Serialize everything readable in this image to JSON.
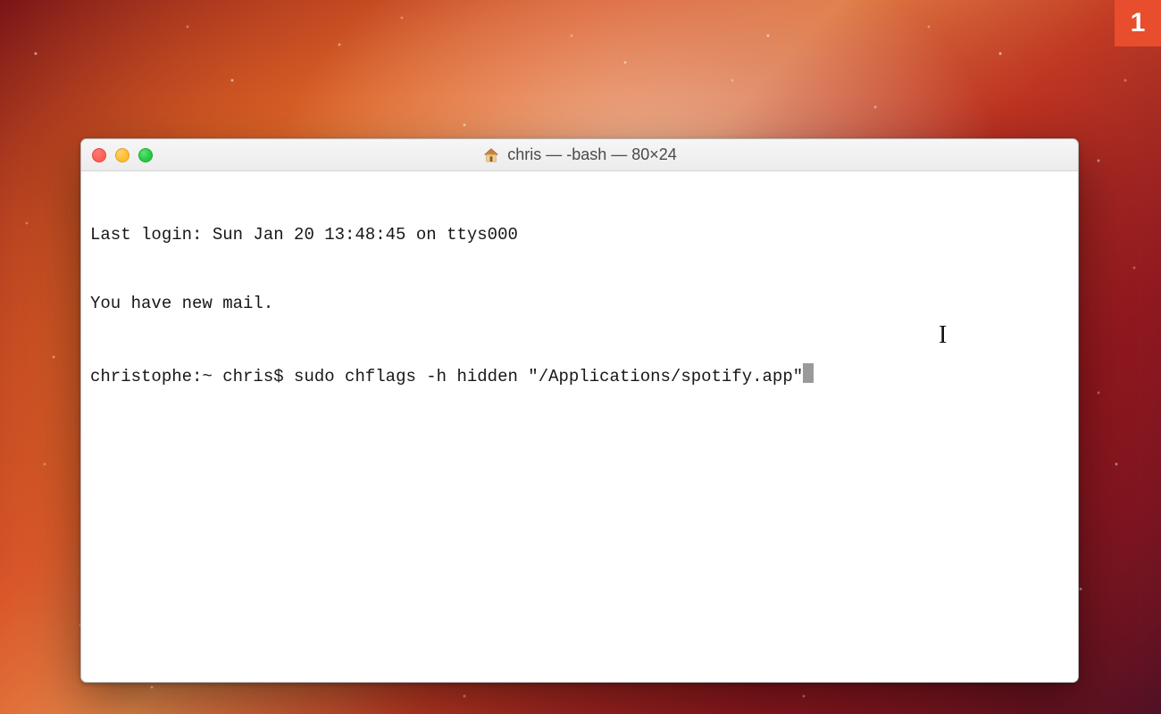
{
  "badge": {
    "number": "1",
    "bg": "#e84d2d"
  },
  "window": {
    "title": "chris — -bash — 80×24",
    "icon": "home-icon"
  },
  "terminal": {
    "lines": [
      "Last login: Sun Jan 20 13:48:45 on ttys000",
      "You have new mail."
    ],
    "prompt": "christophe:~ chris$ ",
    "command": "sudo chflags -h hidden \"/Applications/spotify.app\""
  }
}
